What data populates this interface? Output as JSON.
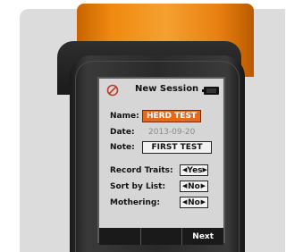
{
  "screen": {
    "title": "New Session",
    "fields": {
      "name_label": "Name:",
      "name_value": "HERD TEST",
      "date_label": "Date:",
      "date_value": "2013-09-20",
      "note_label": "Note:",
      "note_value": "FIRST TEST"
    },
    "options": {
      "record_traits_label": "Record Traits:",
      "record_traits_value": "Yes",
      "sort_by_list_label": "Sort by List:",
      "sort_by_list_value": "No",
      "mothering_label": "Mothering:",
      "mothering_value": "No"
    },
    "soft_keys": [
      "",
      "",
      "Next"
    ]
  },
  "colors": {
    "active_field": "#e26a1a",
    "device_bumper": "#f08a10"
  },
  "icons": [
    "no-entry-icon",
    "battery-icon",
    "left-arrow-icon",
    "right-arrow-icon"
  ]
}
